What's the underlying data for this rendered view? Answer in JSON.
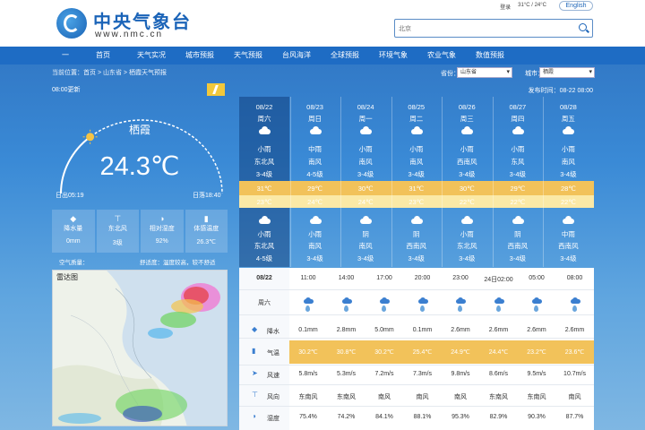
{
  "header": {
    "site_name": "中央气象台",
    "site_url": "www.nmc.cn",
    "top_links": [
      "登录",
      "31°C / 24°C"
    ],
    "english": "English",
    "search_placeholder": "北京"
  },
  "nav": [
    "一",
    "首页",
    "天气实况",
    "城市预报",
    "天气预报",
    "台风海洋",
    "全球预报",
    "环境气象",
    "农业气象",
    "数值预报"
  ],
  "breadcrumb": "当前位置：首页 > 山东省 > 栖霞天气预报",
  "selects": {
    "province_label": "省份：",
    "province_value": "山东省",
    "city_label": "城市：",
    "city_value": "栖霞"
  },
  "publish_time": "发布时间：08-22 08:00",
  "realtime": {
    "label": "08:00更新",
    "city": "栖霞",
    "temperature": "24.3℃",
    "sunrise": "日出05:19",
    "sunset": "日落18:40",
    "sun_position_fraction": 0.28
  },
  "observations": [
    {
      "icon": "raindrop-icon",
      "label": "降水量",
      "value": "0mm"
    },
    {
      "icon": "wind-icon",
      "label": "东北风",
      "value": "3级"
    },
    {
      "icon": "humidity-icon",
      "label": "相对湿度",
      "value": "92%"
    },
    {
      "icon": "thermometer-icon",
      "label": "体感温度",
      "value": "26.3℃"
    }
  ],
  "air_quality": {
    "left": "空气质量：",
    "right": "舒适度：温度较高，较不舒适"
  },
  "radar": {
    "title": "雷达图"
  },
  "forecast": [
    {
      "date": "08/22",
      "week": "周六",
      "day_weather": "小雨",
      "day_wind_dir": "东北风",
      "day_wind_level": "3-4级",
      "high": "31℃",
      "low": "23℃",
      "night_weather": "小雨",
      "night_wind_dir": "东北风",
      "night_wind_level": "4-5级"
    },
    {
      "date": "08/23",
      "week": "周日",
      "day_weather": "中雨",
      "day_wind_dir": "南风",
      "day_wind_level": "4-5级",
      "high": "29℃",
      "low": "24℃",
      "night_weather": "小雨",
      "night_wind_dir": "南风",
      "night_wind_level": "3-4级"
    },
    {
      "date": "08/24",
      "week": "周一",
      "day_weather": "小雨",
      "day_wind_dir": "南风",
      "day_wind_level": "3-4级",
      "high": "30℃",
      "low": "24℃",
      "night_weather": "阴",
      "night_wind_dir": "南风",
      "night_wind_level": "3-4级"
    },
    {
      "date": "08/25",
      "week": "周二",
      "day_weather": "小雨",
      "day_wind_dir": "南风",
      "day_wind_level": "3-4级",
      "high": "31℃",
      "low": "23℃",
      "night_weather": "阴",
      "night_wind_dir": "西南风",
      "night_wind_level": "3-4级"
    },
    {
      "date": "08/26",
      "week": "周三",
      "day_weather": "小雨",
      "day_wind_dir": "西南风",
      "day_wind_level": "3-4级",
      "high": "30℃",
      "low": "22℃",
      "night_weather": "小雨",
      "night_wind_dir": "东北风",
      "night_wind_level": "3-4级"
    },
    {
      "date": "08/27",
      "week": "周四",
      "day_weather": "小雨",
      "day_wind_dir": "东风",
      "day_wind_level": "3-4级",
      "high": "29℃",
      "low": "22℃",
      "night_weather": "阴",
      "night_wind_dir": "西南风",
      "night_wind_level": "3-4级"
    },
    {
      "date": "08/28",
      "week": "周五",
      "day_weather": "小雨",
      "day_wind_dir": "南风",
      "day_wind_level": "3-4级",
      "high": "28℃",
      "low": "22℃",
      "night_weather": "中雨",
      "night_wind_dir": "西南风",
      "night_wind_level": "3-4级"
    }
  ],
  "hourly": {
    "date": "08/22",
    "week": "周六",
    "row_labels": [
      "降水",
      "气温",
      "风速",
      "风向",
      "湿度"
    ],
    "times": [
      "11:00",
      "14:00",
      "17:00",
      "20:00",
      "23:00",
      "24日02:00",
      "05:00",
      "08:00"
    ],
    "precip": [
      "0.1mm",
      "2.8mm",
      "5.0mm",
      "0.1mm",
      "2.6mm",
      "2.6mm",
      "2.6mm",
      "2.6mm"
    ],
    "temp": [
      "30.2℃",
      "30.8℃",
      "30.2℃",
      "25.4℃",
      "24.9℃",
      "24.4℃",
      "23.2℃",
      "23.6℃"
    ],
    "wind_speed": [
      "5.8m/s",
      "5.3m/s",
      "7.2m/s",
      "7.3m/s",
      "9.8m/s",
      "8.6m/s",
      "9.5m/s",
      "10.7m/s"
    ],
    "wind_dir": [
      "东南风",
      "东南风",
      "南风",
      "南风",
      "南风",
      "东南风",
      "东南风",
      "南风"
    ],
    "humidity": [
      "75.4%",
      "74.2%",
      "84.1%",
      "88.1%",
      "95.3%",
      "82.9%",
      "90.3%",
      "87.7%"
    ]
  }
}
